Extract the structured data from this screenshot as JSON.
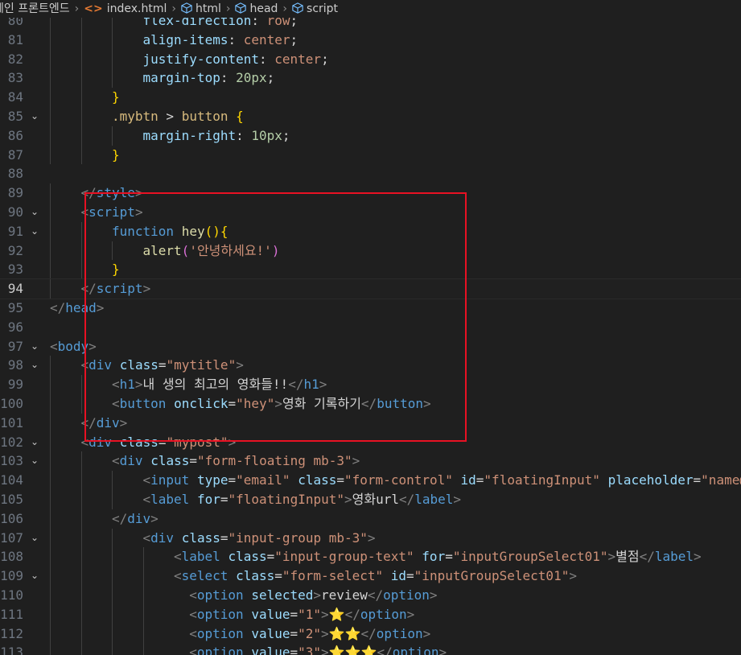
{
  "breadcrumb": {
    "items": [
      "체인 프론트엔드",
      "index.html",
      "html",
      "head",
      "script"
    ]
  },
  "code_lines": [
    {
      "n": "80",
      "fold": false,
      "indent": 3,
      "tokens": [
        [
          "prop",
          "flex-direction"
        ],
        [
          "txt",
          ": "
        ],
        [
          "val",
          "row"
        ],
        [
          "txt",
          ";"
        ]
      ]
    },
    {
      "n": "81",
      "fold": false,
      "indent": 3,
      "tokens": [
        [
          "prop",
          "align-items"
        ],
        [
          "txt",
          ": "
        ],
        [
          "val",
          "center"
        ],
        [
          "txt",
          ";"
        ]
      ]
    },
    {
      "n": "82",
      "fold": false,
      "indent": 3,
      "tokens": [
        [
          "prop",
          "justify-content"
        ],
        [
          "txt",
          ": "
        ],
        [
          "val",
          "center"
        ],
        [
          "txt",
          ";"
        ]
      ]
    },
    {
      "n": "83",
      "fold": false,
      "indent": 3,
      "tokens": [
        [
          "prop",
          "margin-top"
        ],
        [
          "txt",
          ": "
        ],
        [
          "num",
          "20px"
        ],
        [
          "txt",
          ";"
        ]
      ]
    },
    {
      "n": "84",
      "fold": false,
      "indent": 2,
      "tokens": [
        [
          "brace",
          "}"
        ]
      ]
    },
    {
      "n": "85",
      "fold": true,
      "indent": 2,
      "tokens": [
        [
          "sel",
          ".mybtn"
        ],
        [
          "txt",
          " > "
        ],
        [
          "sel",
          "button"
        ],
        [
          "txt",
          " "
        ],
        [
          "brace",
          "{"
        ]
      ]
    },
    {
      "n": "86",
      "fold": false,
      "indent": 3,
      "tokens": [
        [
          "prop",
          "margin-right"
        ],
        [
          "txt",
          ": "
        ],
        [
          "num",
          "10px"
        ],
        [
          "txt",
          ";"
        ]
      ]
    },
    {
      "n": "87",
      "fold": false,
      "indent": 2,
      "tokens": [
        [
          "brace",
          "}"
        ]
      ]
    },
    {
      "n": "88",
      "fold": false,
      "indent": 0,
      "tokens": []
    },
    {
      "n": "89",
      "fold": false,
      "indent": 1,
      "tokens": [
        [
          "punct",
          "</"
        ],
        [
          "tag",
          "style"
        ],
        [
          "punct",
          ">"
        ]
      ]
    },
    {
      "n": "90",
      "fold": true,
      "indent": 1,
      "tokens": [
        [
          "punct",
          "<"
        ],
        [
          "tag",
          "script"
        ],
        [
          "punct",
          ">"
        ]
      ]
    },
    {
      "n": "91",
      "fold": true,
      "indent": 2,
      "tokens": [
        [
          "kw",
          "function"
        ],
        [
          "txt",
          " "
        ],
        [
          "fn",
          "hey"
        ],
        [
          "brace",
          "(){"
        ]
      ]
    },
    {
      "n": "92",
      "fold": false,
      "indent": 3,
      "tokens": [
        [
          "fn",
          "alert"
        ],
        [
          "paren",
          "("
        ],
        [
          "str",
          "'안녕하세요!'"
        ],
        [
          "paren",
          ")"
        ]
      ]
    },
    {
      "n": "93",
      "fold": false,
      "indent": 2,
      "tokens": [
        [
          "brace",
          "}"
        ]
      ]
    },
    {
      "n": "94",
      "fold": false,
      "indent": 1,
      "current": true,
      "tokens": [
        [
          "punct",
          "</"
        ],
        [
          "tag",
          "script"
        ],
        [
          "punct",
          ">"
        ]
      ]
    },
    {
      "n": "95",
      "fold": false,
      "indent": 0,
      "tokens": [
        [
          "punct",
          "</"
        ],
        [
          "tag",
          "head"
        ],
        [
          "punct",
          ">"
        ]
      ]
    },
    {
      "n": "96",
      "fold": false,
      "indent": 0,
      "tokens": []
    },
    {
      "n": "97",
      "fold": true,
      "indent": 0,
      "tokens": [
        [
          "punct",
          "<"
        ],
        [
          "tag",
          "body"
        ],
        [
          "punct",
          ">"
        ]
      ]
    },
    {
      "n": "98",
      "fold": true,
      "indent": 1,
      "tokens": [
        [
          "punct",
          "<"
        ],
        [
          "tag",
          "div"
        ],
        [
          "txt",
          " "
        ],
        [
          "attr",
          "class"
        ],
        [
          "txt",
          "="
        ],
        [
          "str",
          "\"mytitle\""
        ],
        [
          "punct",
          ">"
        ]
      ]
    },
    {
      "n": "99",
      "fold": false,
      "indent": 2,
      "tokens": [
        [
          "punct",
          "<"
        ],
        [
          "tag",
          "h1"
        ],
        [
          "punct",
          ">"
        ],
        [
          "txt",
          "내 생의 최고의 영화들!!"
        ],
        [
          "punct",
          "</"
        ],
        [
          "tag",
          "h1"
        ],
        [
          "punct",
          ">"
        ]
      ]
    },
    {
      "n": "100",
      "fold": false,
      "indent": 2,
      "tokens": [
        [
          "punct",
          "<"
        ],
        [
          "tag",
          "button"
        ],
        [
          "txt",
          " "
        ],
        [
          "attr",
          "onclick"
        ],
        [
          "txt",
          "="
        ],
        [
          "str",
          "\"hey\""
        ],
        [
          "punct",
          ">"
        ],
        [
          "txt",
          "영화 기록하기"
        ],
        [
          "punct",
          "</"
        ],
        [
          "tag",
          "button"
        ],
        [
          "punct",
          ">"
        ]
      ]
    },
    {
      "n": "101",
      "fold": false,
      "indent": 1,
      "tokens": [
        [
          "punct",
          "</"
        ],
        [
          "tag",
          "div"
        ],
        [
          "punct",
          ">"
        ]
      ]
    },
    {
      "n": "102",
      "fold": true,
      "indent": 1,
      "tokens": [
        [
          "punct",
          "<"
        ],
        [
          "tag",
          "div"
        ],
        [
          "txt",
          " "
        ],
        [
          "attr",
          "class"
        ],
        [
          "txt",
          "="
        ],
        [
          "str",
          "\"mypost\""
        ],
        [
          "punct",
          ">"
        ]
      ]
    },
    {
      "n": "103",
      "fold": true,
      "indent": 2,
      "tokens": [
        [
          "punct",
          "<"
        ],
        [
          "tag",
          "div"
        ],
        [
          "txt",
          " "
        ],
        [
          "attr",
          "class"
        ],
        [
          "txt",
          "="
        ],
        [
          "str",
          "\"form-floating mb-3\""
        ],
        [
          "punct",
          ">"
        ]
      ]
    },
    {
      "n": "104",
      "fold": false,
      "indent": 3,
      "tokens": [
        [
          "punct",
          "<"
        ],
        [
          "tag",
          "input"
        ],
        [
          "txt",
          " "
        ],
        [
          "attr",
          "type"
        ],
        [
          "txt",
          "="
        ],
        [
          "str",
          "\"email\""
        ],
        [
          "txt",
          " "
        ],
        [
          "attr",
          "class"
        ],
        [
          "txt",
          "="
        ],
        [
          "str",
          "\"form-control\""
        ],
        [
          "txt",
          " "
        ],
        [
          "attr",
          "id"
        ],
        [
          "txt",
          "="
        ],
        [
          "str",
          "\"floatingInput\""
        ],
        [
          "txt",
          " "
        ],
        [
          "attr",
          "placeholder"
        ],
        [
          "txt",
          "="
        ],
        [
          "str",
          "\"name@"
        ]
      ]
    },
    {
      "n": "105",
      "fold": false,
      "indent": 3,
      "tokens": [
        [
          "punct",
          "<"
        ],
        [
          "tag",
          "label"
        ],
        [
          "txt",
          " "
        ],
        [
          "attr",
          "for"
        ],
        [
          "txt",
          "="
        ],
        [
          "str",
          "\"floatingInput\""
        ],
        [
          "punct",
          ">"
        ],
        [
          "txt",
          "영화url"
        ],
        [
          "punct",
          "</"
        ],
        [
          "tag",
          "label"
        ],
        [
          "punct",
          ">"
        ]
      ]
    },
    {
      "n": "106",
      "fold": false,
      "indent": 2,
      "tokens": [
        [
          "punct",
          "</"
        ],
        [
          "tag",
          "div"
        ],
        [
          "punct",
          ">"
        ]
      ]
    },
    {
      "n": "107",
      "fold": true,
      "indent": 3,
      "tokens": [
        [
          "punct",
          "<"
        ],
        [
          "tag",
          "div"
        ],
        [
          "txt",
          " "
        ],
        [
          "attr",
          "class"
        ],
        [
          "txt",
          "="
        ],
        [
          "str",
          "\"input-group mb-3\""
        ],
        [
          "punct",
          ">"
        ]
      ]
    },
    {
      "n": "108",
      "fold": false,
      "indent": 4,
      "tokens": [
        [
          "punct",
          "<"
        ],
        [
          "tag",
          "label"
        ],
        [
          "txt",
          " "
        ],
        [
          "attr",
          "class"
        ],
        [
          "txt",
          "="
        ],
        [
          "str",
          "\"input-group-text\""
        ],
        [
          "txt",
          " "
        ],
        [
          "attr",
          "for"
        ],
        [
          "txt",
          "="
        ],
        [
          "str",
          "\"inputGroupSelect01\""
        ],
        [
          "punct",
          ">"
        ],
        [
          "txt",
          "별점"
        ],
        [
          "punct",
          "</"
        ],
        [
          "tag",
          "label"
        ],
        [
          "punct",
          ">"
        ]
      ]
    },
    {
      "n": "109",
      "fold": true,
      "indent": 4,
      "tokens": [
        [
          "punct",
          "<"
        ],
        [
          "tag",
          "select"
        ],
        [
          "txt",
          " "
        ],
        [
          "attr",
          "class"
        ],
        [
          "txt",
          "="
        ],
        [
          "str",
          "\"form-select\""
        ],
        [
          "txt",
          " "
        ],
        [
          "attr",
          "id"
        ],
        [
          "txt",
          "="
        ],
        [
          "str",
          "\"inputGroupSelect01\""
        ],
        [
          "punct",
          ">"
        ]
      ]
    },
    {
      "n": "110",
      "fold": false,
      "indent": 4.5,
      "tokens": [
        [
          "punct",
          "<"
        ],
        [
          "tag",
          "option"
        ],
        [
          "txt",
          " "
        ],
        [
          "attr",
          "selected"
        ],
        [
          "punct",
          ">"
        ],
        [
          "txt",
          "review"
        ],
        [
          "punct",
          "</"
        ],
        [
          "tag",
          "option"
        ],
        [
          "punct",
          ">"
        ]
      ]
    },
    {
      "n": "111",
      "fold": false,
      "indent": 4.5,
      "tokens": [
        [
          "punct",
          "<"
        ],
        [
          "tag",
          "option"
        ],
        [
          "txt",
          " "
        ],
        [
          "attr",
          "value"
        ],
        [
          "txt",
          "="
        ],
        [
          "str",
          "\"1\""
        ],
        [
          "punct",
          ">"
        ],
        [
          "txt",
          "⭐"
        ],
        [
          "punct",
          "</"
        ],
        [
          "tag",
          "option"
        ],
        [
          "punct",
          ">"
        ]
      ]
    },
    {
      "n": "112",
      "fold": false,
      "indent": 4.5,
      "tokens": [
        [
          "punct",
          "<"
        ],
        [
          "tag",
          "option"
        ],
        [
          "txt",
          " "
        ],
        [
          "attr",
          "value"
        ],
        [
          "txt",
          "="
        ],
        [
          "str",
          "\"2\""
        ],
        [
          "punct",
          ">"
        ],
        [
          "txt",
          "⭐⭐"
        ],
        [
          "punct",
          "</"
        ],
        [
          "tag",
          "option"
        ],
        [
          "punct",
          ">"
        ]
      ]
    },
    {
      "n": "113",
      "fold": false,
      "indent": 4.5,
      "tokens": [
        [
          "punct",
          "<"
        ],
        [
          "tag",
          "option"
        ],
        [
          "txt",
          " "
        ],
        [
          "attr",
          "value"
        ],
        [
          "txt",
          "="
        ],
        [
          "str",
          "\"3\""
        ],
        [
          "punct",
          ">"
        ],
        [
          "txt",
          "⭐⭐⭐"
        ],
        [
          "punct",
          "</"
        ],
        [
          "tag",
          "option"
        ],
        [
          "punct",
          ">"
        ]
      ]
    }
  ],
  "colors": {
    "background": "#1f1f1f",
    "annotation_box": "#e81123"
  }
}
